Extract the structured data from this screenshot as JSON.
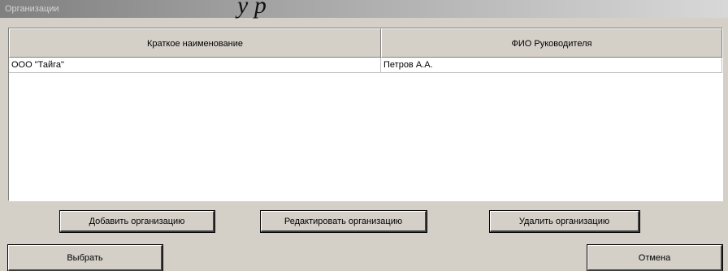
{
  "window": {
    "title": "Организации"
  },
  "caption": "у    р",
  "grid": {
    "columns": [
      "Краткое наименование",
      "ФИО Руководителя"
    ],
    "rows": [
      [
        "ООО \"Тайга\"",
        "Петров А.А."
      ]
    ]
  },
  "buttons": {
    "add": "Добавить организацию",
    "edit": "Редактировать организацию",
    "delete": "Удалить организацию",
    "select": "Выбрать",
    "cancel": "Отмена"
  }
}
